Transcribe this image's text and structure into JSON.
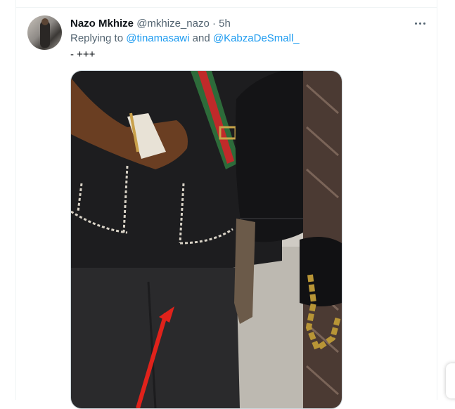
{
  "tweet": {
    "display_name": "Nazo Mkhize",
    "handle": "@mkhize_nazo",
    "separator": "·",
    "time": "5h",
    "replying_prefix": "Replying to ",
    "mention_1": "@tinamasawi",
    "mention_joiner": " and ",
    "mention_2": "@KabzaDeSmall_",
    "text": "- +++"
  },
  "icons": {
    "more": "more-horizontal-icon",
    "avatar": "avatar"
  },
  "colors": {
    "link": "#1d9bf0",
    "muted": "#536471",
    "text": "#0f1419",
    "border": "#eff3f4"
  }
}
